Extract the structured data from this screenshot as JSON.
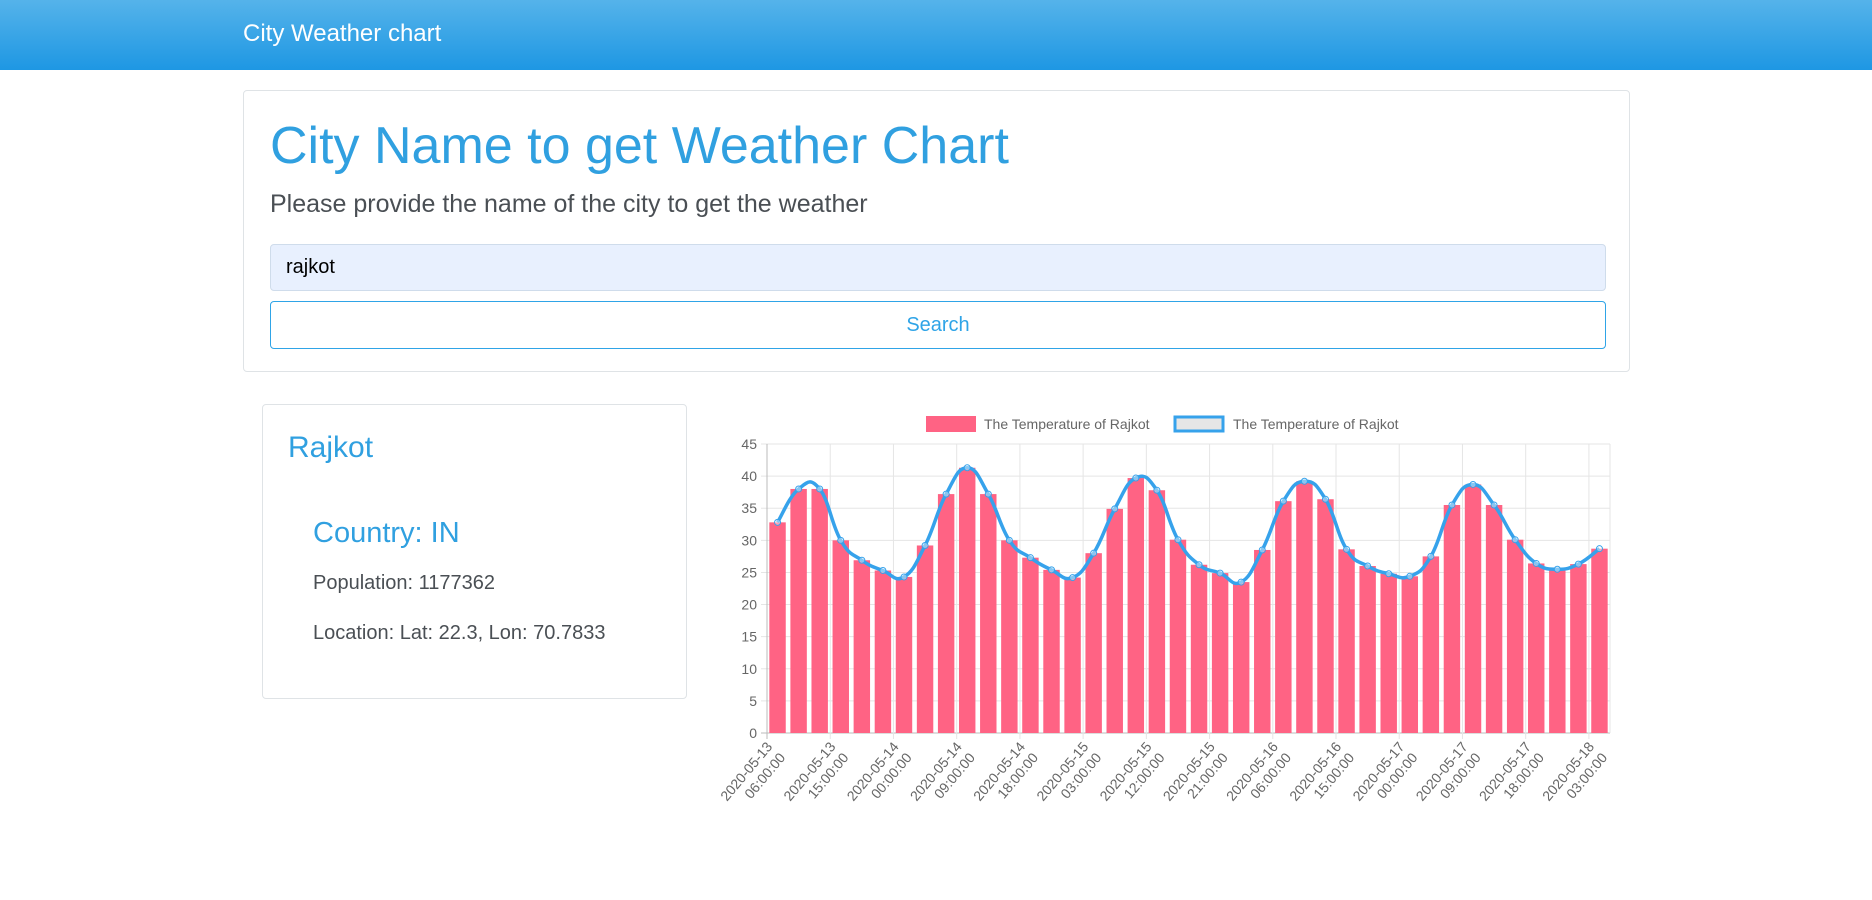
{
  "navbar": {
    "brand": "City Weather chart"
  },
  "search": {
    "title": "City Name to get Weather Chart",
    "subtitle": "Please provide the name of the city to get the weather",
    "input_value": "rajkot",
    "button_label": "Search"
  },
  "city": {
    "name": "Rajkot",
    "country": "Country: IN",
    "population": "Population: 1177362",
    "location": "Location: Lat: 22.3, Lon: 70.7833"
  },
  "colors": {
    "accent": "#2fa4e7",
    "bar": "#ff6384",
    "line": "#36a2eb"
  },
  "chart_data": {
    "type": "bar",
    "series": [
      {
        "name": "The Temperature of Rajkot",
        "type": "bar",
        "values": [
          32.8,
          38,
          38,
          30,
          26.9,
          25.3,
          24.3,
          29.2,
          37.2,
          41.3,
          37.2,
          30,
          27.3,
          25.4,
          24.2,
          28,
          34.9,
          39.7,
          37.8,
          30.1,
          26.2,
          24.9,
          23.5,
          28.5,
          36.1,
          39.2,
          36.4,
          28.6,
          26,
          24.8,
          24.4,
          27.5,
          35.5,
          38.7,
          35.5,
          30.1,
          26.4,
          25.5,
          26.3,
          28.7
        ]
      },
      {
        "name": "The Temperature of Rajkot",
        "type": "line",
        "values": [
          32.8,
          38,
          38,
          30,
          26.9,
          25.3,
          24.3,
          29.2,
          37.2,
          41.3,
          37.2,
          30,
          27.3,
          25.4,
          24.2,
          28,
          34.9,
          39.7,
          37.8,
          30.1,
          26.2,
          24.9,
          23.5,
          28.5,
          36.1,
          39.2,
          36.4,
          28.6,
          26,
          24.8,
          24.4,
          27.5,
          35.5,
          38.7,
          35.5,
          30.1,
          26.4,
          25.5,
          26.3,
          28.7
        ]
      }
    ],
    "x_labels": [
      [
        "2020-05-13",
        "06:00:00"
      ],
      [
        "2020-05-13",
        "15:00:00"
      ],
      [
        "2020-05-14",
        "00:00:00"
      ],
      [
        "2020-05-14",
        "09:00:00"
      ],
      [
        "2020-05-14",
        "18:00:00"
      ],
      [
        "2020-05-15",
        "03:00:00"
      ],
      [
        "2020-05-15",
        "12:00:00"
      ],
      [
        "2020-05-15",
        "21:00:00"
      ],
      [
        "2020-05-16",
        "06:00:00"
      ],
      [
        "2020-05-16",
        "15:00:00"
      ],
      [
        "2020-05-17",
        "00:00:00"
      ],
      [
        "2020-05-17",
        "09:00:00"
      ],
      [
        "2020-05-17",
        "18:00:00"
      ],
      [
        "2020-05-18",
        "03:00:00"
      ]
    ],
    "ylim": [
      0,
      45
    ],
    "yticks": [
      0,
      5,
      10,
      15,
      20,
      25,
      30,
      35,
      40,
      45
    ],
    "grid": true,
    "legend": "top"
  }
}
